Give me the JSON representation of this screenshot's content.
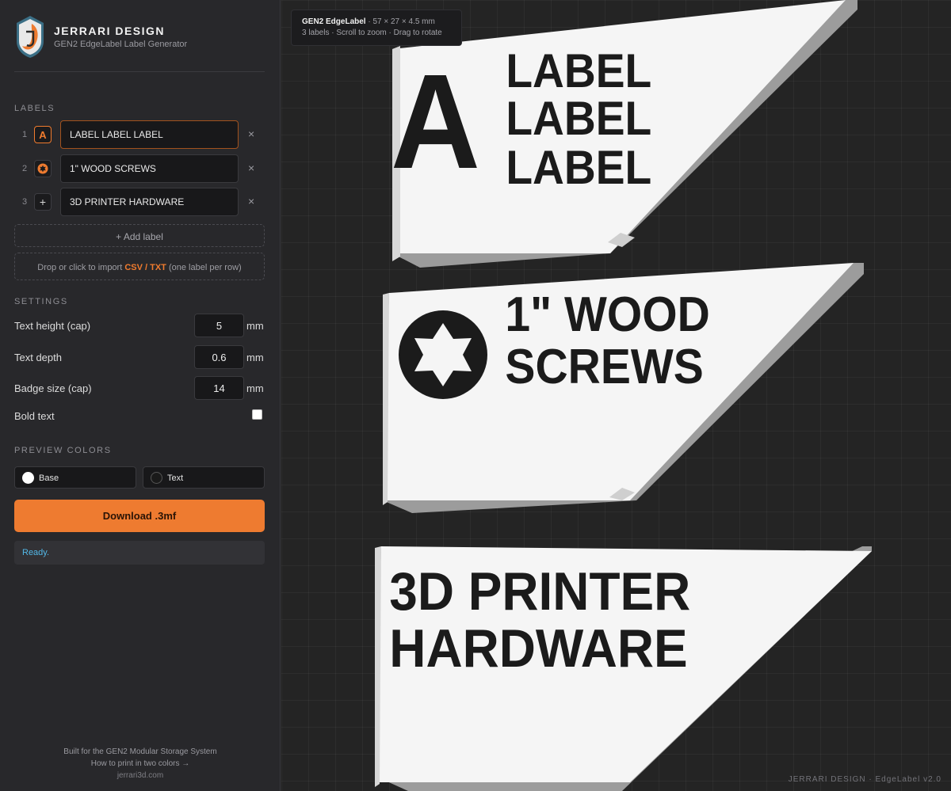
{
  "brand": {
    "title": "JERRARI DESIGN",
    "subtitle": "GEN2 EdgeLabel Label Generator"
  },
  "labels_section": {
    "heading": "LABELS",
    "items": [
      {
        "number": "1",
        "badge": "A",
        "badge_icon": "letter-a-icon",
        "value": "LABEL LABEL LABEL"
      },
      {
        "number": "2",
        "badge": "",
        "badge_icon": "torx-screw-icon",
        "value": "1\" WOOD SCREWS"
      },
      {
        "number": "3",
        "badge": "+",
        "badge_icon": "plus-icon",
        "value": "3D PRINTER HARDWARE"
      }
    ],
    "remove_label": "×",
    "add_label": "+ Add label",
    "import_prefix": "Drop or click to import",
    "import_formats": "CSV / TXT",
    "import_suffix": "(one label per row)"
  },
  "settings": {
    "heading": "SETTINGS",
    "text_height": {
      "label": "Text height (cap)",
      "value": "5",
      "unit": "mm"
    },
    "text_depth": {
      "label": "Text depth",
      "value": "0.6",
      "unit": "mm"
    },
    "badge_size": {
      "label": "Badge size (cap)",
      "value": "14",
      "unit": "mm"
    },
    "bold_text": {
      "label": "Bold text",
      "checked": false
    }
  },
  "preview_colors": {
    "heading": "PREVIEW COLORS",
    "base": {
      "label": "Base",
      "color": "#ffffff"
    },
    "text": {
      "label": "Text",
      "color": "#1a1a1a"
    }
  },
  "download_label": "Download .3mf",
  "status": "Ready.",
  "footer": {
    "line1": "Built for the GEN2 Modular Storage System",
    "line2": "How to print in two colors →",
    "line3": "jerrari3d.com"
  },
  "viewport": {
    "tooltip_title": "GEN2 EdgeLabel",
    "tooltip_dims": "· 57 × 27 × 4.5 mm",
    "tooltip_hint": "3 labels · Scroll to zoom · Drag to rotate",
    "watermark": "JERRARI DESIGN · EdgeLabel v2.0",
    "preview": [
      {
        "badge": "A",
        "lines": [
          "LABEL",
          "LABEL",
          "LABEL"
        ]
      },
      {
        "badge_icon": "torx-screw-icon",
        "lines": [
          "1\" WOOD",
          "SCREWS"
        ]
      },
      {
        "lines": [
          "3D PRINTER",
          "HARDWARE"
        ]
      }
    ]
  },
  "colors": {
    "accent": "#ee7b30",
    "status": "#53b8e8",
    "sidebar_bg": "#28282b",
    "viewport_bg": "#242424"
  }
}
